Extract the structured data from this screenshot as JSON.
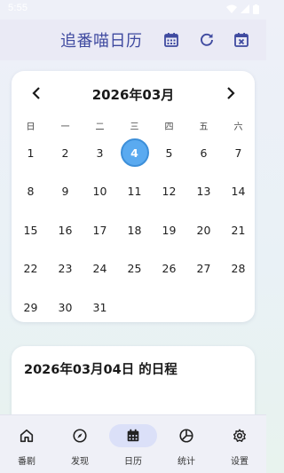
{
  "status_bar": {
    "time": "5:55",
    "icons": [
      "wifi-icon",
      "cellular-signal-icon",
      "battery-icon"
    ]
  },
  "app_bar": {
    "title": "追番喵日历",
    "actions": [
      "calendar-month-icon",
      "refresh-icon",
      "clear-calendar-icon"
    ]
  },
  "calendar": {
    "month_label": "2026年03月",
    "weekdays": [
      "日",
      "一",
      "二",
      "三",
      "四",
      "五",
      "六"
    ],
    "first_weekday_index": 0,
    "days": [
      "1",
      "2",
      "3",
      "4",
      "5",
      "6",
      "7",
      "8",
      "9",
      "10",
      "11",
      "12",
      "13",
      "14",
      "15",
      "16",
      "17",
      "18",
      "19",
      "20",
      "21",
      "22",
      "23",
      "24",
      "25",
      "26",
      "27",
      "28",
      "29",
      "30",
      "31"
    ],
    "selected_day": "4",
    "selected_color": "#5aaaf0"
  },
  "schedule": {
    "title": "2026年03月04日 的日程"
  },
  "bottom_nav": {
    "items": [
      {
        "label": "番剧",
        "icon": "home-icon"
      },
      {
        "label": "发现",
        "icon": "compass-icon"
      },
      {
        "label": "日历",
        "icon": "calendar-icon"
      },
      {
        "label": "统计",
        "icon": "pie-chart-icon"
      },
      {
        "label": "设置",
        "icon": "gear-icon"
      }
    ],
    "active_index": 2
  },
  "colors": {
    "accent": "#3f4aa0",
    "nav_active_pill": "#dbe0f8"
  }
}
